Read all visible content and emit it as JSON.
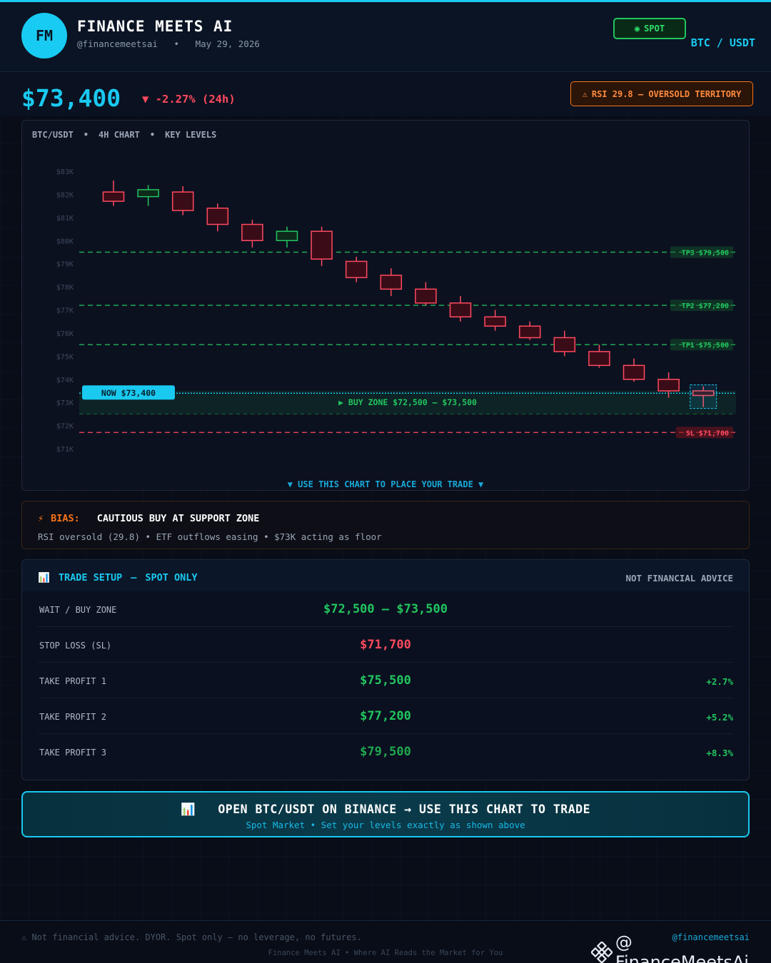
{
  "header": {
    "logo_initials": "FM",
    "brand": "FINANCE MEETS AI",
    "handle": "@financemeetsai",
    "separator": "•",
    "date": "May 29, 2026",
    "badge_icon": "◉",
    "badge_label": "SPOT",
    "pair": "BTC / USDT"
  },
  "price": {
    "current": "$73,400",
    "change": "▼ -2.27% (24h)",
    "rsi_icon": "⚠",
    "rsi_alert": "RSI 29.8 — OVERSOLD TERRITORY"
  },
  "chart_head": {
    "pair": "BTC/USDT",
    "timeframe": "4H CHART",
    "levels": "KEY LEVELS",
    "separator": "•"
  },
  "chart_footer": "▼  USE THIS CHART TO PLACE YOUR TRADE  ▼",
  "chart_data": {
    "type": "candlestick",
    "y_ticks": [
      83000,
      82000,
      81000,
      80000,
      79000,
      78000,
      77000,
      76000,
      75000,
      74000,
      73000,
      72000,
      71000
    ],
    "y_tick_labels": [
      "$83K",
      "$82K",
      "$81K",
      "$80K",
      "$79K",
      "$78K",
      "$77K",
      "$76K",
      "$75K",
      "$74K",
      "$73K",
      "$72K",
      "$71K"
    ],
    "ylim": [
      70700,
      83600
    ],
    "candles": [
      {
        "o": 82100,
        "h": 82600,
        "l": 81500,
        "c": 81700
      },
      {
        "o": 81900,
        "h": 82400,
        "l": 81500,
        "c": 82200
      },
      {
        "o": 82100,
        "h": 82350,
        "l": 81100,
        "c": 81300
      },
      {
        "o": 81400,
        "h": 81600,
        "l": 80400,
        "c": 80700
      },
      {
        "o": 80700,
        "h": 80900,
        "l": 79700,
        "c": 80000
      },
      {
        "o": 80000,
        "h": 80600,
        "l": 79700,
        "c": 80400
      },
      {
        "o": 80400,
        "h": 80600,
        "l": 78900,
        "c": 79200
      },
      {
        "o": 79100,
        "h": 79300,
        "l": 78200,
        "c": 78400
      },
      {
        "o": 78500,
        "h": 78800,
        "l": 77600,
        "c": 77900
      },
      {
        "o": 77900,
        "h": 78200,
        "l": 77200,
        "c": 77300
      },
      {
        "o": 77300,
        "h": 77600,
        "l": 76500,
        "c": 76700
      },
      {
        "o": 76700,
        "h": 77000,
        "l": 76100,
        "c": 76300
      },
      {
        "o": 76300,
        "h": 76500,
        "l": 75700,
        "c": 75800
      },
      {
        "o": 75800,
        "h": 76100,
        "l": 75000,
        "c": 75200
      },
      {
        "o": 75200,
        "h": 75500,
        "l": 74500,
        "c": 74600
      },
      {
        "o": 74600,
        "h": 74900,
        "l": 73900,
        "c": 74000
      },
      {
        "o": 74000,
        "h": 74300,
        "l": 73200,
        "c": 73500
      },
      {
        "o": 73500,
        "h": 73700,
        "l": 72800,
        "c": 73300
      }
    ],
    "levels": [
      {
        "name": "TP3",
        "label": "TP3 $79,500",
        "value": 79500,
        "color": "#22c55e"
      },
      {
        "name": "TP2",
        "label": "TP2 $77,200",
        "value": 77200,
        "color": "#22c55e"
      },
      {
        "name": "TP1",
        "label": "TP1 $75,500",
        "value": 75500,
        "color": "#22c55e"
      },
      {
        "name": "SL",
        "label": "SL $71,700",
        "value": 71700,
        "color": "#ff4a5e"
      }
    ],
    "buy_zone": {
      "low": 72500,
      "high": 73500,
      "label": "▶ BUY ZONE  $72,500 – $73,500"
    },
    "now": {
      "value": 73400,
      "label": "NOW  $73,400"
    },
    "colors": {
      "bull": "#22c55e",
      "bear": "#ff4a5e",
      "now": "#19c9f0"
    }
  },
  "bias": {
    "icon": "⚡",
    "label": "BIAS:",
    "text": "CAUTIOUS BUY AT SUPPORT ZONE",
    "sub": "RSI oversold (29.8) • ETF outflows easing • $73K acting as floor"
  },
  "setup": {
    "icon": "📊",
    "title": "TRADE SETUP",
    "dash": "—",
    "subtitle": "SPOT ONLY",
    "disclaimer": "NOT FINANCIAL ADVICE",
    "rows": [
      {
        "label": "WAIT / BUY ZONE",
        "value": "$72,500 – $73,500",
        "pct": "",
        "color": "#22c55e"
      },
      {
        "label": "STOP LOSS (SL)",
        "value": "$71,700",
        "pct": "",
        "color": "#ff4a5e"
      },
      {
        "label": "TAKE PROFIT 1",
        "value": "$75,500",
        "pct": "+2.7%",
        "color": "#22c55e"
      },
      {
        "label": "TAKE PROFIT 2",
        "value": "$77,200",
        "pct": "+5.2%",
        "color": "#22c55e"
      },
      {
        "label": "TAKE PROFIT 3",
        "value": "$79,500",
        "pct": "+8.3%",
        "color": "#1fa84f"
      }
    ]
  },
  "cta": {
    "icon": "📊",
    "main": "OPEN BTC/USDT ON BINANCE → USE THIS CHART TO TRADE",
    "sub": "Spot Market  •  Set your levels exactly as shown above"
  },
  "footer": {
    "note": "⚠ Not financial advice. DYOR. Spot only — no leverage, no futures.",
    "handle": "@financemeetsai",
    "tagline": "Finance Meets AI  •  Where AI Reads the Market for You"
  },
  "watermark": {
    "icon": "binance-logo-icon",
    "text": "@ FinanceMeetsAi"
  }
}
